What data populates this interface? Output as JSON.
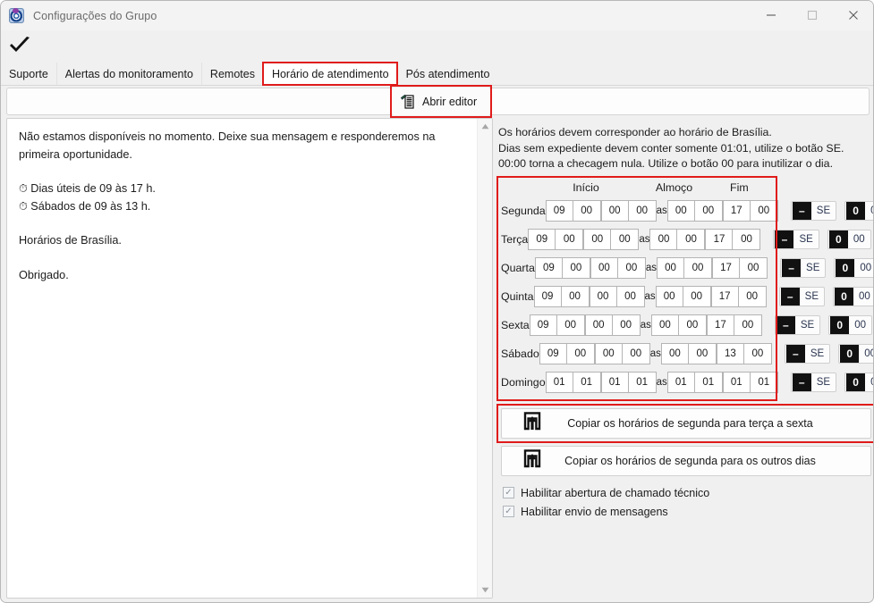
{
  "window": {
    "title": "Configurações do Grupo",
    "icon": "globe-icon",
    "minimize": "minimize-icon",
    "maximize": "maximize-icon",
    "close": "close-icon",
    "confirm_icon": "checkmark-icon"
  },
  "tabs": [
    {
      "label": "Suporte",
      "selected": false
    },
    {
      "label": "Alertas do monitoramento",
      "selected": false
    },
    {
      "label": "Remotes",
      "selected": false
    },
    {
      "label": "Horário de atendimento",
      "selected": true
    },
    {
      "label": "Pós atendimento",
      "selected": false
    }
  ],
  "toolbar": {
    "open_editor_label": "Abrir editor",
    "open_editor_icon": "document-edit-icon"
  },
  "message_panel": {
    "paragraph1": "Não estamos disponíveis no momento. Deixe sua mensagem e responderemos na primeira oportunidade.",
    "line_weekdays": "Dias úteis de 09 às 17 h.",
    "line_saturday": "Sábados de 09 às 13 h.",
    "line_timezone": "Horários de Brasília.",
    "line_thanks": "Obrigado.",
    "clock_icon": "clock-icon",
    "scroll_up_icon": "scroll-up-arrow-icon",
    "scroll_down_icon": "scroll-down-arrow-icon"
  },
  "notice": {
    "line1": "Os horários devem corresponder ao horário de Brasília.",
    "line2": "Dias sem expediente devem conter somente 01:01, utilize o botão SE.",
    "line3": "00:00 torna a checagem nula. Utilize o botão 00 para inutilizar o dia."
  },
  "schedule": {
    "headers": {
      "day": "",
      "start": "Início",
      "lunch": "Almoço",
      "end": "Fim"
    },
    "between_label": "as",
    "se_button_label": "SE",
    "zero_button_label": "00",
    "se_button_icon": "minus-square-icon",
    "zero_button_icon": "zero-square-icon",
    "rows": [
      {
        "day": "Segunda",
        "start_h": "09",
        "start_m": "00",
        "lunch_from_h": "00",
        "lunch_from_m": "00",
        "lunch_to_h": "00",
        "lunch_to_m": "00",
        "end_h": "17",
        "end_m": "00"
      },
      {
        "day": "Terça",
        "start_h": "09",
        "start_m": "00",
        "lunch_from_h": "00",
        "lunch_from_m": "00",
        "lunch_to_h": "00",
        "lunch_to_m": "00",
        "end_h": "17",
        "end_m": "00"
      },
      {
        "day": "Quarta",
        "start_h": "09",
        "start_m": "00",
        "lunch_from_h": "00",
        "lunch_from_m": "00",
        "lunch_to_h": "00",
        "lunch_to_m": "00",
        "end_h": "17",
        "end_m": "00"
      },
      {
        "day": "Quinta",
        "start_h": "09",
        "start_m": "00",
        "lunch_from_h": "00",
        "lunch_from_m": "00",
        "lunch_to_h": "00",
        "lunch_to_m": "00",
        "end_h": "17",
        "end_m": "00"
      },
      {
        "day": "Sexta",
        "start_h": "09",
        "start_m": "00",
        "lunch_from_h": "00",
        "lunch_from_m": "00",
        "lunch_to_h": "00",
        "lunch_to_m": "00",
        "end_h": "17",
        "end_m": "00"
      },
      {
        "day": "Sábado",
        "start_h": "09",
        "start_m": "00",
        "lunch_from_h": "00",
        "lunch_from_m": "00",
        "lunch_to_h": "00",
        "lunch_to_m": "00",
        "end_h": "13",
        "end_m": "00"
      },
      {
        "day": "Domingo",
        "start_h": "01",
        "start_m": "01",
        "lunch_from_h": "01",
        "lunch_from_m": "01",
        "lunch_to_h": "01",
        "lunch_to_m": "01",
        "end_h": "01",
        "end_m": "01"
      }
    ]
  },
  "copy_buttons": [
    {
      "label": "Copiar os horários de segunda para terça a sexta",
      "icon": "copy-up-arrow-icon",
      "highlighted": true
    },
    {
      "label": "Copiar os horários de segunda para os outros dias",
      "icon": "copy-up-arrow-icon",
      "highlighted": false
    }
  ],
  "checkboxes": [
    {
      "label": "Habilitar abertura de chamado técnico",
      "checked": true
    },
    {
      "label": "Habilitar envio de mensagens",
      "checked": true
    }
  ],
  "colors": {
    "highlight": "#e01b1b",
    "window_bg": "#f0f0f0",
    "panel_bg": "#ffffff",
    "text": "#1c1c1c"
  }
}
